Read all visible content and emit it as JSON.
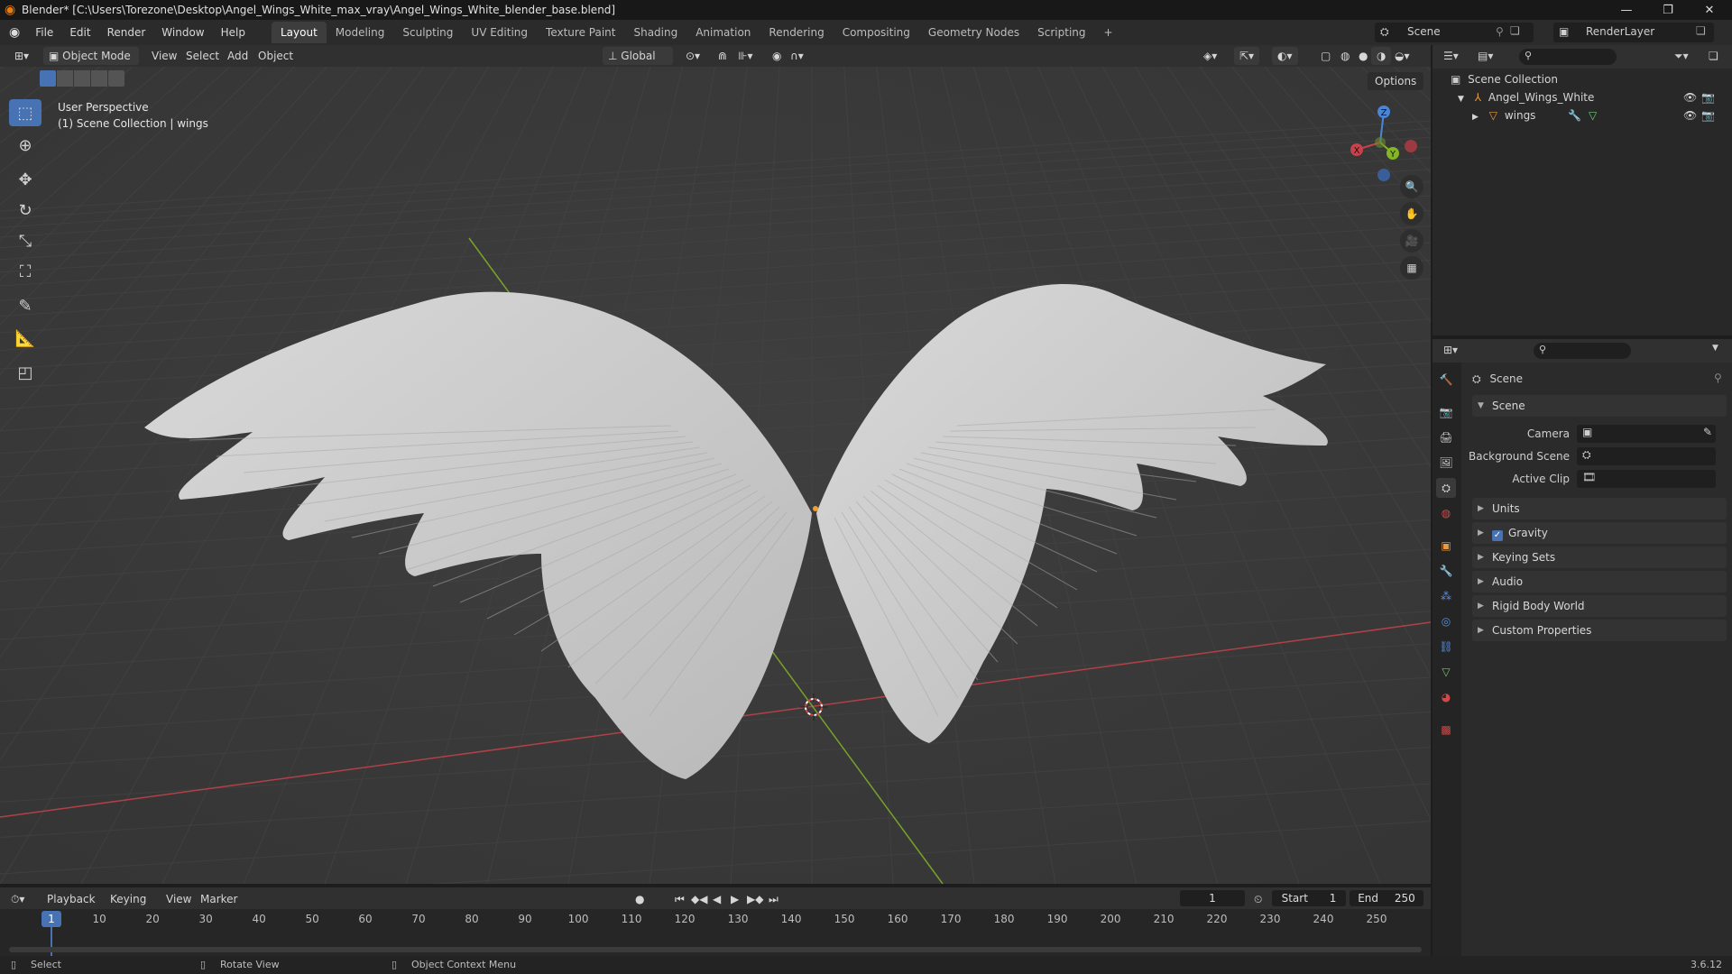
{
  "window": {
    "title": "Blender* [C:\\Users\\Torezone\\Desktop\\Angel_Wings_White_max_vray\\Angel_Wings_White_blender_base.blend]",
    "minimize": "—",
    "maximize": "❐",
    "close": "✕"
  },
  "menu": [
    "File",
    "Edit",
    "Render",
    "Window",
    "Help"
  ],
  "workspaces": [
    "Layout",
    "Modeling",
    "Sculpting",
    "UV Editing",
    "Texture Paint",
    "Shading",
    "Animation",
    "Rendering",
    "Compositing",
    "Geometry Nodes",
    "Scripting",
    "+"
  ],
  "active_workspace": "Layout",
  "scene_name": "Scene",
  "render_layer": "RenderLayer",
  "viewport": {
    "mode": "Object Mode",
    "menus": [
      "View",
      "Select",
      "Add",
      "Object"
    ],
    "transform": "Global",
    "options": "Options",
    "info_line1": "User Perspective",
    "info_line2": "(1) Scene Collection | wings"
  },
  "gizmo": {
    "z": "Z",
    "y": "Y",
    "x": "X"
  },
  "outliner": {
    "root": "Scene Collection",
    "collection": "Angel_Wings_White",
    "object": "wings"
  },
  "properties": {
    "header": "Scene",
    "section": "Scene",
    "fields": [
      {
        "label": "Camera"
      },
      {
        "label": "Background Scene"
      },
      {
        "label": "Active Clip"
      }
    ],
    "subsections": [
      "Units",
      "Gravity",
      "Keying Sets",
      "Audio",
      "Rigid Body World",
      "Custom Properties"
    ],
    "gravity_checked": true
  },
  "timeline": {
    "menus": [
      "Playback",
      "Keying",
      "View",
      "Marker"
    ],
    "current_frame": "1",
    "start_label": "Start",
    "start": "1",
    "end_label": "End",
    "end": "250",
    "ticks": [
      "1",
      "10",
      "20",
      "30",
      "40",
      "50",
      "60",
      "70",
      "80",
      "90",
      "100",
      "110",
      "120",
      "130",
      "140",
      "150",
      "160",
      "170",
      "180",
      "190",
      "200",
      "210",
      "220",
      "230",
      "240",
      "250"
    ]
  },
  "status": {
    "select": "Select",
    "rotate": "Rotate View",
    "context": "Object Context Menu",
    "version": "3.6.12"
  },
  "colors": {
    "accent": "#4772b3",
    "x_axis": "#c7424b",
    "y_axis": "#83b527",
    "z_axis": "#4a86d8"
  }
}
